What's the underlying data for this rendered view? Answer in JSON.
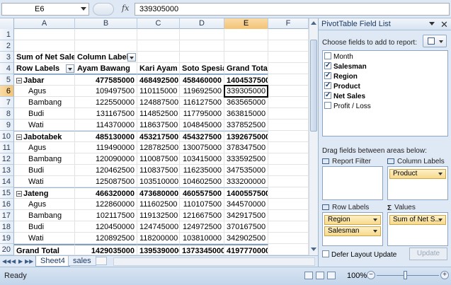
{
  "formula_bar": {
    "name_box": "E6",
    "fx": "fx",
    "value": "339305000"
  },
  "columns": [
    "A",
    "B",
    "C",
    "D",
    "E",
    "F"
  ],
  "selected_column": "E",
  "selected_row": "6",
  "pivot": {
    "measure": "Sum of Net Sales",
    "column_labels": "Column Labels",
    "row_labels": "Row Labels",
    "headers": [
      "Ayam Bawang",
      "Kari Ayam",
      "Soto Spesial",
      "Grand Total"
    ],
    "rows": [
      {
        "n": "5",
        "label": "Jabar",
        "kind": "group",
        "values": [
          "477585000",
          "468492500",
          "458460000",
          "1404537500"
        ]
      },
      {
        "n": "6",
        "label": "Agus",
        "kind": "item",
        "values": [
          "109497500",
          "110115000",
          "119692500",
          "339305000"
        ]
      },
      {
        "n": "7",
        "label": "Bambang",
        "kind": "item",
        "values": [
          "122550000",
          "124887500",
          "116127500",
          "363565000"
        ]
      },
      {
        "n": "8",
        "label": "Budi",
        "kind": "item",
        "values": [
          "131167500",
          "114852500",
          "117795000",
          "363815000"
        ]
      },
      {
        "n": "9",
        "label": "Wati",
        "kind": "item",
        "values": [
          "114370000",
          "118637500",
          "104845000",
          "337852500"
        ]
      },
      {
        "n": "10",
        "label": "Jabotabek",
        "kind": "group",
        "values": [
          "485130000",
          "453217500",
          "454327500",
          "1392675000"
        ]
      },
      {
        "n": "11",
        "label": "Agus",
        "kind": "item",
        "values": [
          "119490000",
          "128782500",
          "130075000",
          "378347500"
        ]
      },
      {
        "n": "12",
        "label": "Bambang",
        "kind": "item",
        "values": [
          "120090000",
          "110087500",
          "103415000",
          "333592500"
        ]
      },
      {
        "n": "13",
        "label": "Budi",
        "kind": "item",
        "values": [
          "120462500",
          "110837500",
          "116235000",
          "347535000"
        ]
      },
      {
        "n": "14",
        "label": "Wati",
        "kind": "item",
        "values": [
          "125087500",
          "103510000",
          "104602500",
          "333200000"
        ]
      },
      {
        "n": "15",
        "label": "Jateng",
        "kind": "group",
        "values": [
          "466320000",
          "473680000",
          "460557500",
          "1400557500"
        ]
      },
      {
        "n": "16",
        "label": "Agus",
        "kind": "item",
        "values": [
          "122860000",
          "111602500",
          "110107500",
          "344570000"
        ]
      },
      {
        "n": "17",
        "label": "Bambang",
        "kind": "item",
        "values": [
          "102117500",
          "119132500",
          "121667500",
          "342917500"
        ]
      },
      {
        "n": "18",
        "label": "Budi",
        "kind": "item",
        "values": [
          "120450000",
          "124745000",
          "124972500",
          "370167500"
        ]
      },
      {
        "n": "19",
        "label": "Wati",
        "kind": "item",
        "values": [
          "120892500",
          "118200000",
          "103810000",
          "342902500"
        ]
      },
      {
        "n": "20",
        "label": "Grand Total",
        "kind": "total",
        "values": [
          "1429035000",
          "1395390000",
          "1373345000",
          "4197770000"
        ]
      }
    ]
  },
  "sheet_tabs": {
    "active": "Sheet4",
    "other": "sales"
  },
  "status": {
    "ready": "Ready",
    "zoom": "100%",
    "zoom_minus": "−",
    "zoom_plus": "+"
  },
  "panel": {
    "title": "PivotTable Field List",
    "choose_label": "Choose fields to add to report:",
    "fields": [
      {
        "label": "Month",
        "checked": false
      },
      {
        "label": "Salesman",
        "checked": true
      },
      {
        "label": "Region",
        "checked": true
      },
      {
        "label": "Product",
        "checked": true
      },
      {
        "label": "Net Sales",
        "checked": true
      },
      {
        "label": "Profit / Loss",
        "checked": false
      }
    ],
    "drag_label": "Drag fields between areas below:",
    "report_filter": "Report Filter",
    "column_labels": "Column Labels",
    "row_labels": "Row Labels",
    "values": "Values",
    "column_chip": "Product",
    "row_chips": [
      "Region",
      "Salesman"
    ],
    "value_chip": "Sum of Net S...",
    "defer_label": "Defer Layout Update",
    "update_label": "Update"
  },
  "icons": {
    "close": "close-icon",
    "fx": "fx-icon",
    "layout": "layout-icon"
  }
}
